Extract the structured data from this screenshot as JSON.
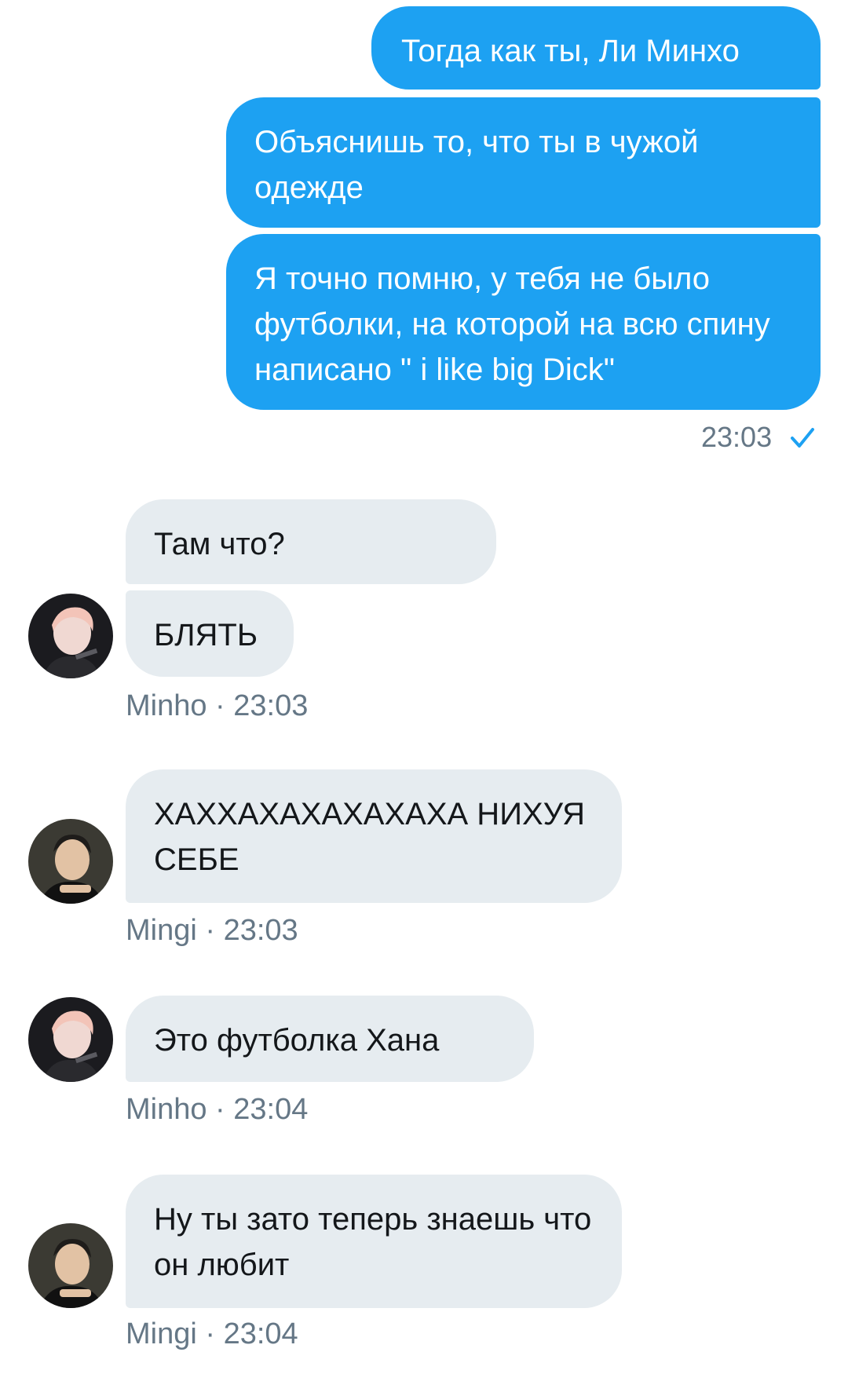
{
  "sent": {
    "messages": [
      "Тогда как ты, Ли Минхо",
      "Объяснишь то, что ты в чужой одежде",
      "Я точно помню, у тебя не было футболки, на которой на всю спину написано \" i like big Dick\""
    ],
    "time": "23:03",
    "status_icon": "checkmark-icon"
  },
  "received": [
    {
      "sender": "Minho",
      "time": "23:03",
      "messages": [
        "Там что?",
        "БЛЯТЬ"
      ]
    },
    {
      "sender": "Mingi",
      "time": "23:03",
      "messages": [
        "ХАХХАХАХАХАХАХА НИХУЯ СЕБЕ"
      ]
    },
    {
      "sender": "Minho",
      "time": "23:04",
      "messages": [
        "Это футболка Хана"
      ]
    },
    {
      "sender": "Mingi",
      "time": "23:04",
      "messages": [
        "Ну ты зато теперь знаешь что он любит"
      ]
    }
  ],
  "meta_separator": " · ",
  "colors": {
    "sent_bubble": "#1da1f2",
    "received_bubble": "#e6ecf0",
    "meta_text": "#657786"
  }
}
